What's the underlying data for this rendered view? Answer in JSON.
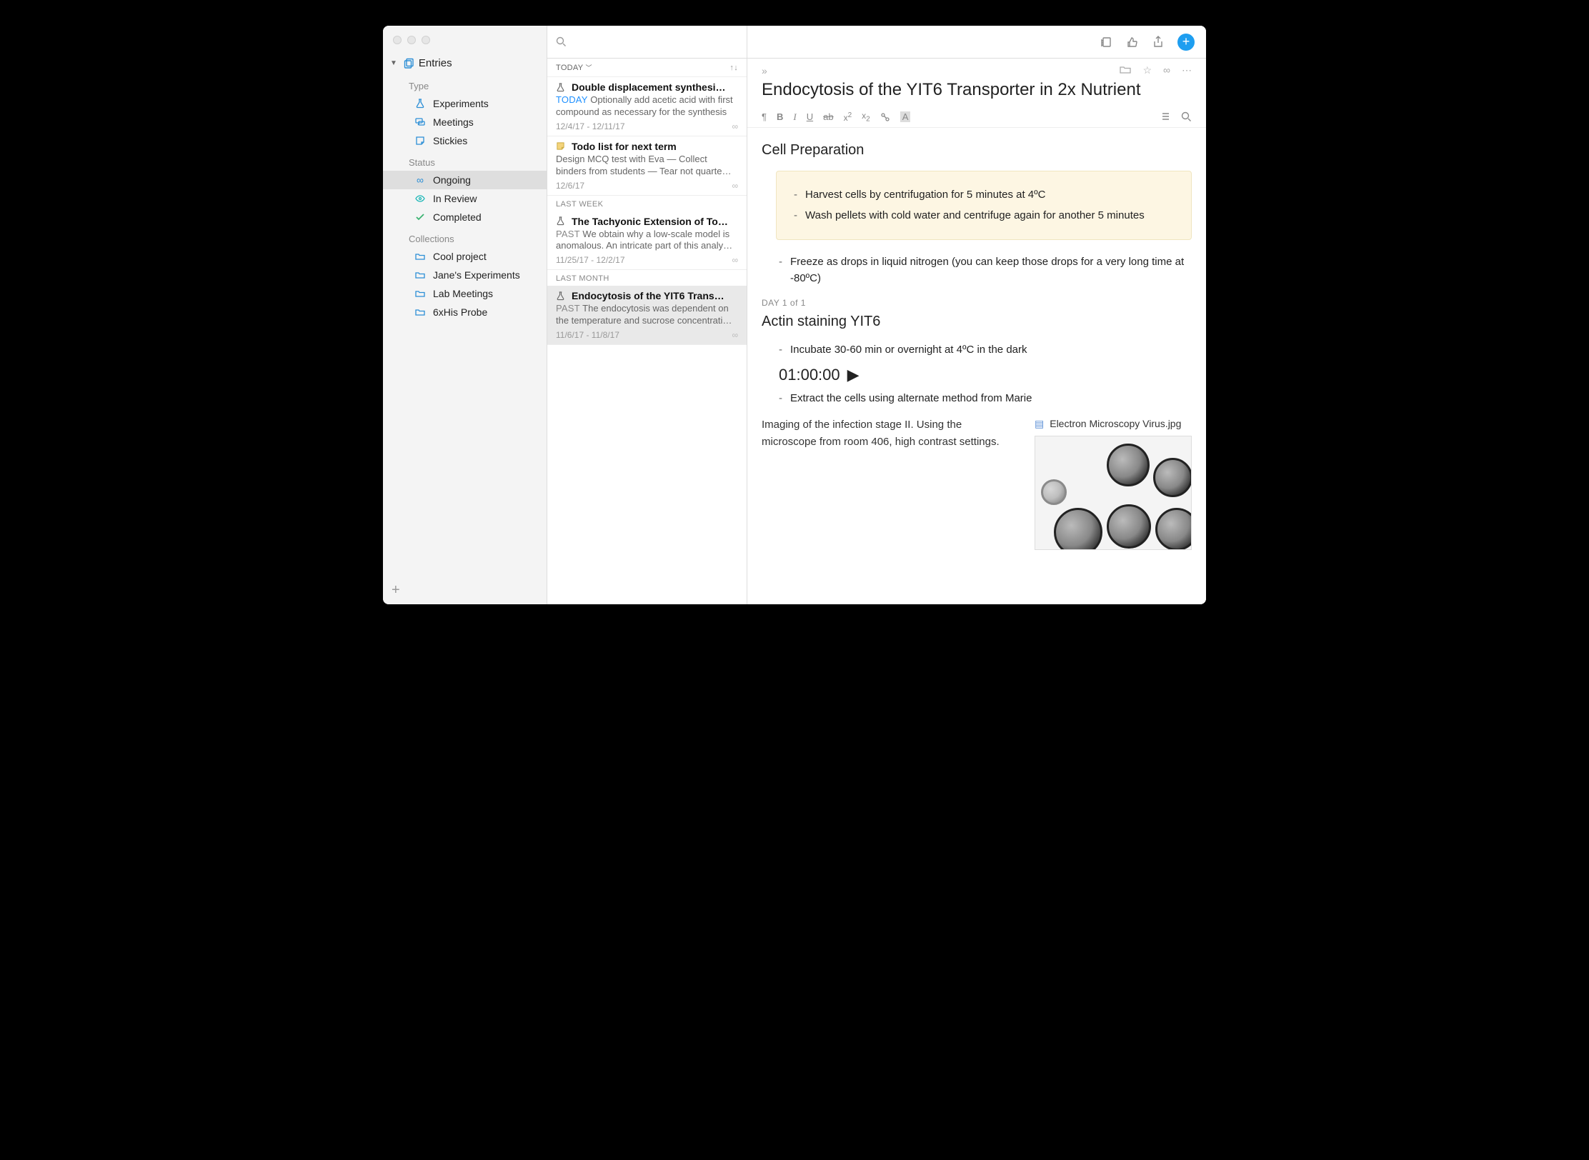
{
  "sidebar": {
    "root_label": "Entries",
    "sections": {
      "type": {
        "label": "Type",
        "items": [
          {
            "label": "Experiments"
          },
          {
            "label": "Meetings"
          },
          {
            "label": "Stickies"
          }
        ]
      },
      "status": {
        "label": "Status",
        "items": [
          {
            "label": "Ongoing",
            "selected": true
          },
          {
            "label": "In Review"
          },
          {
            "label": "Completed"
          }
        ]
      },
      "collections": {
        "label": "Collections",
        "items": [
          {
            "label": "Cool project"
          },
          {
            "label": "Jane's Experiments"
          },
          {
            "label": "Lab Meetings"
          },
          {
            "label": "6xHis Probe"
          }
        ]
      }
    }
  },
  "list": {
    "sort_label": "TODAY",
    "groups": [
      {
        "label": null,
        "entries": [
          {
            "icon": "flask",
            "title": "Double displacement synthesi…",
            "prefix": "TODAY",
            "preview": "Optionally add acetic acid with first compound as necessary for the synthesis",
            "date": "12/4/17 - 12/11/17",
            "ongoing": true
          },
          {
            "icon": "note",
            "title": "Todo list for next term",
            "prefix": "",
            "preview": "Design MCQ test with Eva — Collect binders from students — Tear not quarte…",
            "date": "12/6/17",
            "ongoing": true
          }
        ]
      },
      {
        "label": "LAST WEEK",
        "entries": [
          {
            "icon": "flask",
            "title": "The Tachyonic Extension of To…",
            "prefix": "PAST",
            "preview": "We obtain why a low-scale model is anomalous. An intricate part of this analy…",
            "date": "11/25/17 - 12/2/17",
            "ongoing": true
          }
        ]
      },
      {
        "label": "LAST MONTH",
        "entries": [
          {
            "icon": "flask",
            "title": "Endocytosis of the YIT6 Trans…",
            "selected": true,
            "prefix": "PAST",
            "preview": "The endocytosis was dependent on the temperature and sucrose concentrati…",
            "date": "11/6/17 - 11/8/17",
            "ongoing": true
          }
        ]
      }
    ]
  },
  "note": {
    "title": "Endocytosis of the YIT6 Transporter in 2x Nutrient",
    "section1_heading": "Cell Preparation",
    "callout_items": [
      "Harvest cells by centrifugation for 5 minutes at 4ºC",
      "Wash pellets with cold water and centrifuge again for another 5 minutes"
    ],
    "after_callout": "Freeze as drops in liquid nitrogen (you can keep those drops for a very long time at -80ºC)",
    "day_tag": "DAY 1 of 1",
    "section2_heading": "Actin staining YIT6",
    "list2_item1": "Incubate 30-60 min or overnight at 4ºC in the dark",
    "timer": "01:00:00",
    "list2_item2": "Extract the cells using alternate method from Marie",
    "imaging_text": "Imaging of the infection stage II. Using the microscope from room 406, high contrast settings.",
    "attachment_name": "Electron Microscopy Virus.jpg"
  },
  "format_bar": {
    "paragraph": "¶",
    "bold": "B",
    "italic": "I",
    "underline": "U",
    "strike": "ab",
    "sup": "x",
    "sub": "x",
    "link": "A"
  }
}
